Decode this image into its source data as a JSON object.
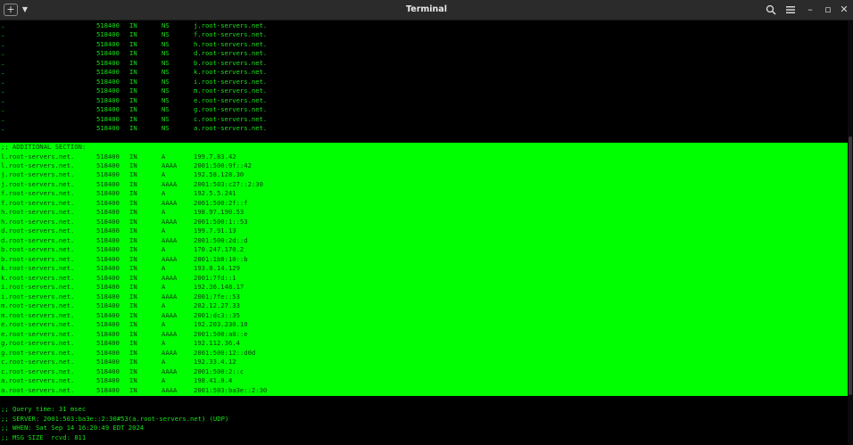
{
  "window": {
    "title": "Terminal",
    "new_tab_glyph": "+",
    "dropdown_glyph": "▼",
    "minimize_glyph": "–",
    "maximize_glyph": "▫",
    "close_glyph": "✕"
  },
  "terminal": {
    "answer_lines": [
      {
        "name": ".",
        "ttl": "518400",
        "class": "IN",
        "type": "NS",
        "value": "j.root-servers.net."
      },
      {
        "name": ".",
        "ttl": "518400",
        "class": "IN",
        "type": "NS",
        "value": "f.root-servers.net."
      },
      {
        "name": ".",
        "ttl": "518400",
        "class": "IN",
        "type": "NS",
        "value": "h.root-servers.net."
      },
      {
        "name": ".",
        "ttl": "518400",
        "class": "IN",
        "type": "NS",
        "value": "d.root-servers.net."
      },
      {
        "name": ".",
        "ttl": "518400",
        "class": "IN",
        "type": "NS",
        "value": "b.root-servers.net."
      },
      {
        "name": ".",
        "ttl": "518400",
        "class": "IN",
        "type": "NS",
        "value": "k.root-servers.net."
      },
      {
        "name": ".",
        "ttl": "518400",
        "class": "IN",
        "type": "NS",
        "value": "i.root-servers.net."
      },
      {
        "name": ".",
        "ttl": "518400",
        "class": "IN",
        "type": "NS",
        "value": "m.root-servers.net."
      },
      {
        "name": ".",
        "ttl": "518400",
        "class": "IN",
        "type": "NS",
        "value": "e.root-servers.net."
      },
      {
        "name": ".",
        "ttl": "518400",
        "class": "IN",
        "type": "NS",
        "value": "g.root-servers.net."
      },
      {
        "name": ".",
        "ttl": "518400",
        "class": "IN",
        "type": "NS",
        "value": "c.root-servers.net."
      },
      {
        "name": ".",
        "ttl": "518400",
        "class": "IN",
        "type": "NS",
        "value": "a.root-servers.net."
      }
    ],
    "additional_header": ";; ADDITIONAL SECTION:",
    "additional_lines": [
      {
        "name": "l.root-servers.net.",
        "ttl": "518400",
        "class": "IN",
        "type": "A",
        "value": "199.7.83.42"
      },
      {
        "name": "l.root-servers.net.",
        "ttl": "518400",
        "class": "IN",
        "type": "AAAA",
        "value": "2001:500:9f::42"
      },
      {
        "name": "j.root-servers.net.",
        "ttl": "518400",
        "class": "IN",
        "type": "A",
        "value": "192.58.128.30"
      },
      {
        "name": "j.root-servers.net.",
        "ttl": "518400",
        "class": "IN",
        "type": "AAAA",
        "value": "2001:503:c27::2:30"
      },
      {
        "name": "f.root-servers.net.",
        "ttl": "518400",
        "class": "IN",
        "type": "A",
        "value": "192.5.5.241"
      },
      {
        "name": "f.root-servers.net.",
        "ttl": "518400",
        "class": "IN",
        "type": "AAAA",
        "value": "2001:500:2f::f"
      },
      {
        "name": "h.root-servers.net.",
        "ttl": "518400",
        "class": "IN",
        "type": "A",
        "value": "198.97.190.53"
      },
      {
        "name": "h.root-servers.net.",
        "ttl": "518400",
        "class": "IN",
        "type": "AAAA",
        "value": "2001:500:1::53"
      },
      {
        "name": "d.root-servers.net.",
        "ttl": "518400",
        "class": "IN",
        "type": "A",
        "value": "199.7.91.13"
      },
      {
        "name": "d.root-servers.net.",
        "ttl": "518400",
        "class": "IN",
        "type": "AAAA",
        "value": "2001:500:2d::d"
      },
      {
        "name": "b.root-servers.net.",
        "ttl": "518400",
        "class": "IN",
        "type": "A",
        "value": "170.247.170.2"
      },
      {
        "name": "b.root-servers.net.",
        "ttl": "518400",
        "class": "IN",
        "type": "AAAA",
        "value": "2801:1b8:10::b"
      },
      {
        "name": "k.root-servers.net.",
        "ttl": "518400",
        "class": "IN",
        "type": "A",
        "value": "193.0.14.129"
      },
      {
        "name": "k.root-servers.net.",
        "ttl": "518400",
        "class": "IN",
        "type": "AAAA",
        "value": "2001:7fd::1"
      },
      {
        "name": "i.root-servers.net.",
        "ttl": "518400",
        "class": "IN",
        "type": "A",
        "value": "192.36.148.17"
      },
      {
        "name": "i.root-servers.net.",
        "ttl": "518400",
        "class": "IN",
        "type": "AAAA",
        "value": "2001:7fe::53"
      },
      {
        "name": "m.root-servers.net.",
        "ttl": "518400",
        "class": "IN",
        "type": "A",
        "value": "202.12.27.33"
      },
      {
        "name": "m.root-servers.net.",
        "ttl": "518400",
        "class": "IN",
        "type": "AAAA",
        "value": "2001:dc3::35"
      },
      {
        "name": "e.root-servers.net.",
        "ttl": "518400",
        "class": "IN",
        "type": "A",
        "value": "192.203.230.10"
      },
      {
        "name": "e.root-servers.net.",
        "ttl": "518400",
        "class": "IN",
        "type": "AAAA",
        "value": "2001:500:a8::e"
      },
      {
        "name": "g.root-servers.net.",
        "ttl": "518400",
        "class": "IN",
        "type": "A",
        "value": "192.112.36.4"
      },
      {
        "name": "g.root-servers.net.",
        "ttl": "518400",
        "class": "IN",
        "type": "AAAA",
        "value": "2001:500:12::d0d"
      },
      {
        "name": "c.root-servers.net.",
        "ttl": "518400",
        "class": "IN",
        "type": "A",
        "value": "192.33.4.12"
      },
      {
        "name": "c.root-servers.net.",
        "ttl": "518400",
        "class": "IN",
        "type": "AAAA",
        "value": "2001:500:2::c"
      },
      {
        "name": "a.root-servers.net.",
        "ttl": "518400",
        "class": "IN",
        "type": "A",
        "value": "198.41.0.4"
      },
      {
        "name": "a.root-servers.net.",
        "ttl": "518400",
        "class": "IN",
        "type": "AAAA",
        "value": "2001:503:ba3e::2:30"
      }
    ],
    "footer_lines": [
      ";; Query time: 31 msec",
      ";; SERVER: 2001:503:ba3e::2:30#53(a.root-servers.net) (UDP)",
      ";; WHEN: Sat Sep 14 16:20:49 EDT 2024",
      ";; MSG SIZE  rcvd: 811"
    ]
  },
  "colors": {
    "text_green": "#16e016",
    "selection_bg": "#00ff00",
    "selection_text": "#0b3a0b",
    "background": "#000000"
  }
}
